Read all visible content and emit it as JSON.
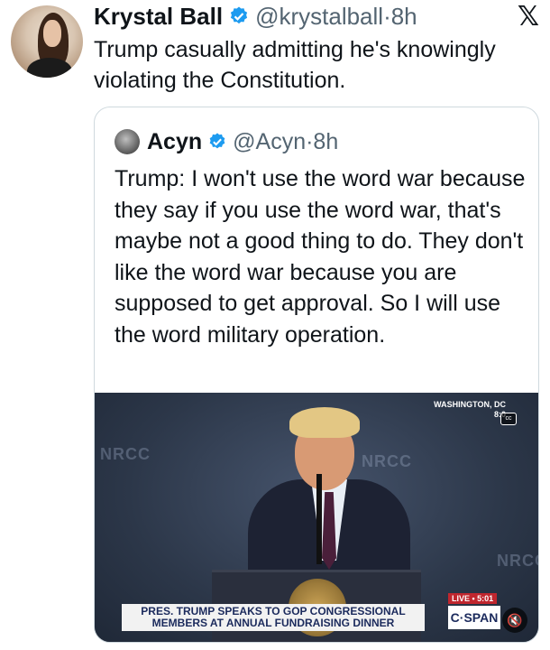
{
  "tweet": {
    "author_name": "Krystal Ball",
    "handle_time": "@krystalball·8h",
    "text": "Trump casually admitting he's knowingly violating the Constitution.",
    "avatar_icon": "profile-photo"
  },
  "quote": {
    "author_name": "Acyn",
    "handle_time": "@Acyn·8h",
    "text": "Trump: I won't use the word war because they say if you use the word war, that's maybe not a good thing to do. They don't like the word war because you are supposed to get approval. So I will use the word military operation."
  },
  "video": {
    "location": "WASHINGTON, DC",
    "time": "8:0",
    "cc_label": "cc",
    "caption_line1": "PRES. TRUMP SPEAKS TO GOP CONGRESSIONAL",
    "caption_line2": "MEMBERS AT ANNUAL FUNDRAISING DINNER",
    "live_label": "LIVE • 5:01",
    "network": "C·SPAN",
    "watermark": "NRCC"
  },
  "colors": {
    "verified": "#1d9bf0",
    "handle": "#536471",
    "border": "#cfd9de"
  }
}
